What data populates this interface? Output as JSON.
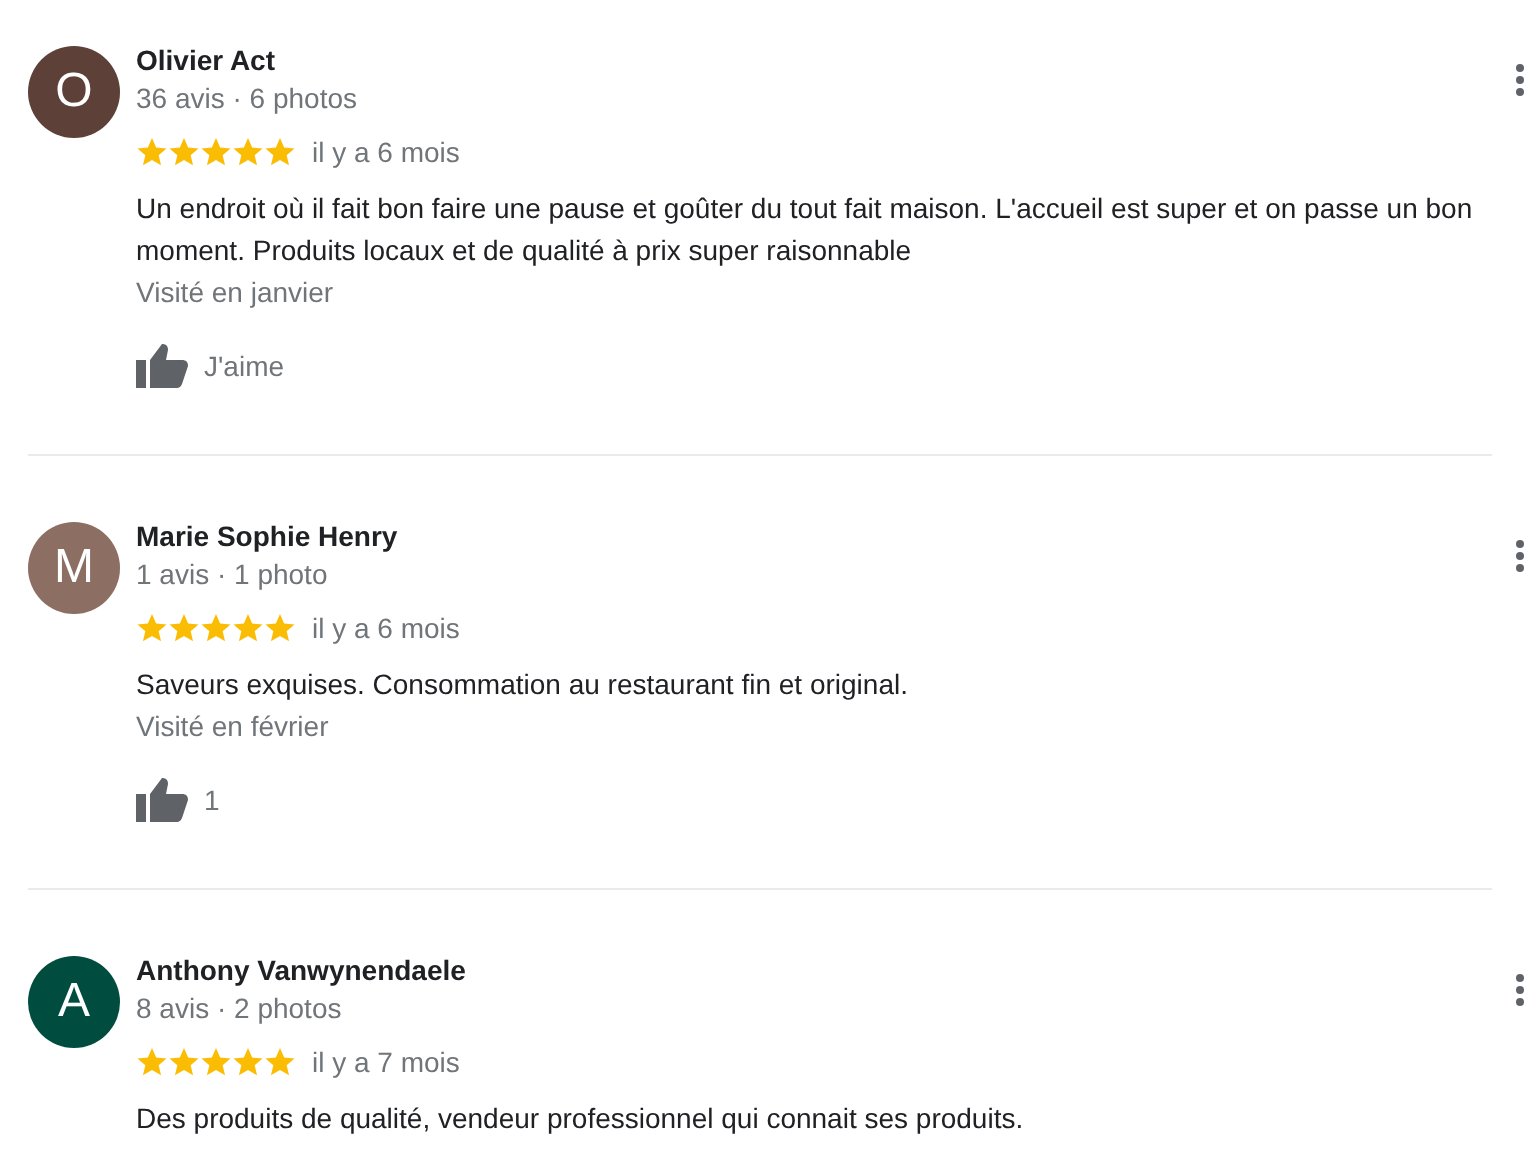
{
  "reviews": [
    {
      "initial": "O",
      "color": "#5d4037",
      "name": "Olivier Act",
      "meta": "36 avis · 6 photos",
      "stars": 5,
      "time": "il y a 6 mois",
      "text": "Un endroit où il fait bon faire une pause et goûter du tout fait maison. L'accueil est super et on passe un bon moment. Produits locaux et de qualité à prix super raisonnable",
      "visited": "Visité en janvier",
      "like": "J'aime"
    },
    {
      "initial": "M",
      "color": "#8d6e63",
      "name": "Marie Sophie Henry",
      "meta": "1 avis · 1 photo",
      "stars": 5,
      "time": "il y a 6 mois",
      "text": "Saveurs exquises. Consommation au restaurant fin et original.",
      "visited": "Visité en février",
      "like": "1"
    },
    {
      "initial": "A",
      "color": "#004d40",
      "name": "Anthony Vanwynendaele",
      "meta": "8 avis · 2 photos",
      "stars": 5,
      "time": "il y a 7 mois",
      "text": "Des produits de qualité, vendeur professionnel qui connait ses produits."
    }
  ]
}
